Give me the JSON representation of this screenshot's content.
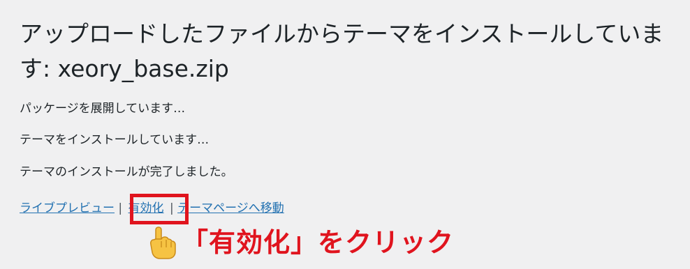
{
  "heading": {
    "title": "アップロードしたファイルからテーマをインストールしています: xeory_base.zip"
  },
  "status": {
    "unpacking": "パッケージを展開しています…",
    "installing": "テーマをインストールしています…",
    "completed": "テーマのインストールが完了しました。"
  },
  "actions": {
    "live_preview": "ライブプレビュー",
    "separator": "|",
    "activate": "有効化",
    "theme_page": "テーマページへ移動"
  },
  "annotation": {
    "icon": "pointing-hand-icon",
    "text": "「有効化」をクリック",
    "color": "#e0141e"
  },
  "colors": {
    "background": "#f0f0f1",
    "link": "#2271b1",
    "text": "#1d2327",
    "highlight": "#e0141e"
  }
}
